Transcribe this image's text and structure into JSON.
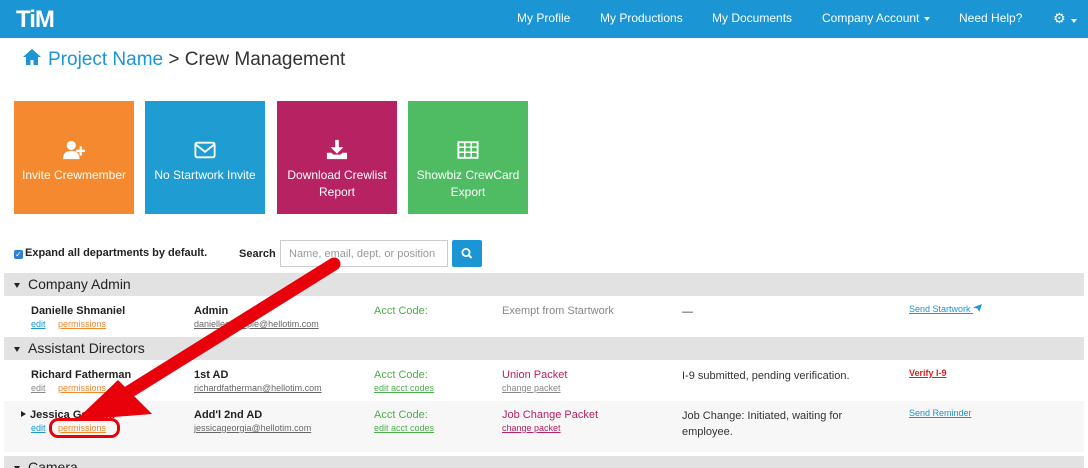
{
  "navbar": {
    "logo": "TiM",
    "items": [
      "My Profile",
      "My Productions",
      "My Documents",
      "Company Account",
      "Need Help?"
    ]
  },
  "breadcrumb": {
    "project": "Project Name",
    "separator": ">",
    "current": "Crew Management"
  },
  "tiles": [
    {
      "label": "Invite Crewmember",
      "icon": "add-user-icon",
      "color": "#f5892f"
    },
    {
      "label": "No Startwork Invite",
      "icon": "envelope-icon",
      "color": "#1f9dd2"
    },
    {
      "label": "Download Crewlist Report",
      "icon": "download-icon",
      "color": "#b72262"
    },
    {
      "label": "Showbiz CrewCard Export",
      "icon": "table-icon",
      "color": "#4fbb63"
    }
  ],
  "controls": {
    "expand_label": "Expand all departments by default.",
    "expand_checked": true,
    "search_label": "Search",
    "search_placeholder": "Name, email, dept. or position"
  },
  "departments": [
    {
      "name": "Company Admin",
      "rows": [
        {
          "name": "Danielle Shmaniel",
          "edit": "edit",
          "permissions": "permissions",
          "role": "Admin",
          "email": "danielleexample@hellotim.com",
          "acct": "Acct Code:",
          "acct_link": "",
          "packet": "Exempt from Startwork",
          "packet_link": "",
          "status": "—",
          "action": "Send Startwork"
        }
      ]
    },
    {
      "name": "Assistant Directors",
      "rows": [
        {
          "name": "Richard Fatherman",
          "edit": "edit",
          "permissions": "permissions",
          "role": "1st AD",
          "email": "richardfatherman@hellotim.com",
          "acct": "Acct Code:",
          "acct_link": "edit acct codes",
          "packet": "Union Packet",
          "packet_link": "change packet",
          "status": "I-9 submitted, pending verification.",
          "action": "Verify I-9"
        },
        {
          "name": "Jessica Georgia",
          "edit": "edit",
          "permissions": "permissions",
          "role": "Add'l 2nd AD",
          "email": "jessicageorgia@hellotim.com",
          "acct": "Acct Code:",
          "acct_link": "edit acct codes",
          "packet": "Job Change Packet",
          "packet_link": "change packet",
          "status_line1": "Job Change: Initiated, waiting for",
          "status_line2": "employee.",
          "action": "Send Reminder"
        }
      ]
    },
    {
      "name": "Camera"
    }
  ]
}
